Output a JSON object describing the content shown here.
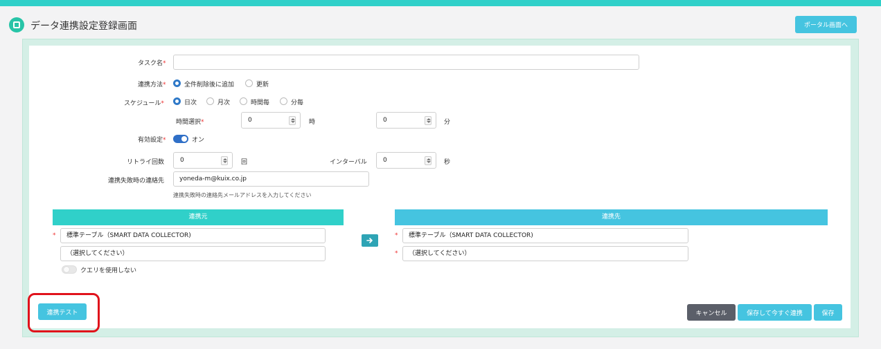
{
  "header": {
    "title": "データ連携設定登録画面",
    "portal_button": "ポータル画面へ"
  },
  "form": {
    "task_name": {
      "label": "タスク名",
      "required_mark": "*",
      "value": ""
    },
    "method": {
      "label": "連携方法",
      "required_mark": "*",
      "options": [
        {
          "label": "全件削除後に追加",
          "selected": true
        },
        {
          "label": "更新",
          "selected": false
        }
      ]
    },
    "schedule": {
      "label": "スケジュール",
      "required_mark": "*",
      "options": [
        {
          "label": "日次",
          "selected": true
        },
        {
          "label": "月次",
          "selected": false
        },
        {
          "label": "時間毎",
          "selected": false
        },
        {
          "label": "分毎",
          "selected": false
        }
      ]
    },
    "time_select": {
      "label": "時間選択",
      "required_mark": "*",
      "hour_value": "0",
      "hour_unit": "時",
      "minute_value": "0",
      "minute_unit": "分"
    },
    "enabled": {
      "label": "有効設定",
      "required_mark": "*",
      "state_label": "オン",
      "on": true
    },
    "retry": {
      "label": "リトライ回数",
      "value": "0",
      "unit": "回"
    },
    "interval": {
      "label": "インターバル",
      "value": "0",
      "unit": "秒"
    },
    "failure_contact": {
      "label": "連携失敗時の連絡先",
      "value": "yoneda-m@kuix.co.jp",
      "hint": "連携失敗時の連絡先メールアドレスを入力してください"
    }
  },
  "source": {
    "heading": "連携元",
    "required_mark": "*",
    "table_type": "標準テーブル（SMART DATA COLLECTOR)",
    "selection": "（選択してください）",
    "query_toggle_label": "クエリを使用しない"
  },
  "destination": {
    "heading": "連携先",
    "required_mark": "*",
    "table_type": "標準テーブル（SMART DATA COLLECTOR)",
    "selection": "（選択してください）"
  },
  "buttons": {
    "test": "連携テスト",
    "cancel": "キャンセル",
    "save_and_run": "保存して今すぐ連携",
    "save": "保存"
  },
  "colors": {
    "accent_teal": "#30d0c9",
    "button_blue": "#45c4e0",
    "cancel_gray": "#5b5f69",
    "highlight_red": "#e0121b"
  }
}
